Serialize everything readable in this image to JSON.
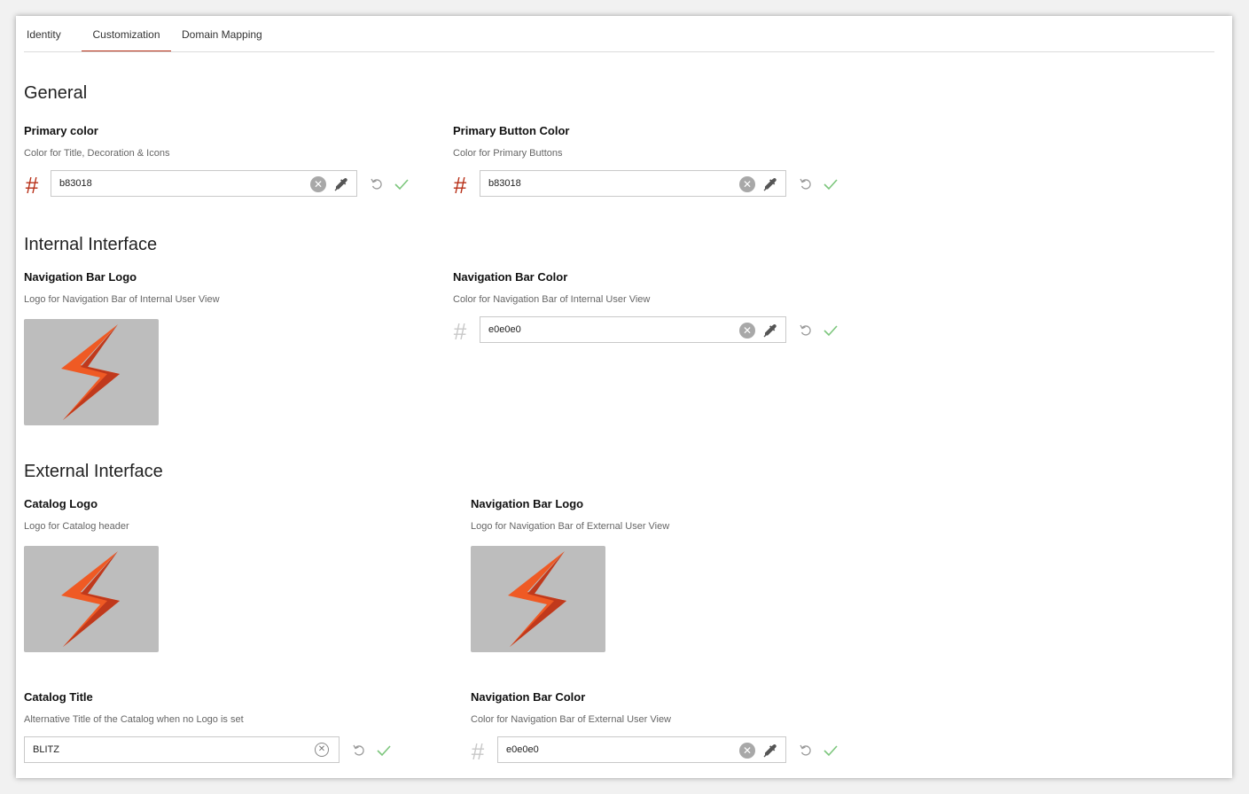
{
  "tabs": [
    {
      "label": "Identity"
    },
    {
      "label": "Customization"
    },
    {
      "label": "Domain Mapping"
    }
  ],
  "active_tab": "Customization",
  "colors": {
    "accent": "#b83018",
    "logo_bg": "#bdbdbd",
    "ok": "#7cc67c"
  },
  "general": {
    "title": "General",
    "primary_color": {
      "label": "Primary color",
      "desc": "Color for Title, Decoration & Icons",
      "value": "b83018",
      "hash": "#"
    },
    "primary_button_color": {
      "label": "Primary Button Color",
      "desc": "Color for Primary Buttons",
      "value": "b83018",
      "hash": "#"
    }
  },
  "internal": {
    "title": "Internal Interface",
    "nav_logo": {
      "label": "Navigation Bar Logo",
      "desc": "Logo for Navigation Bar of Internal User View",
      "icon": "lightning-bolt-icon"
    },
    "nav_color": {
      "label": "Navigation Bar Color",
      "desc": "Color for Navigation Bar of Internal User View",
      "value": "e0e0e0",
      "hash": "#"
    }
  },
  "external": {
    "title": "External Interface",
    "catalog_logo": {
      "label": "Catalog Logo",
      "desc": "Logo for Catalog header",
      "icon": "lightning-bolt-icon"
    },
    "nav_logo": {
      "label": "Navigation Bar Logo",
      "desc": "Logo for Navigation Bar of External User View",
      "icon": "lightning-bolt-icon"
    },
    "catalog_title": {
      "label": "Catalog Title",
      "desc": "Alternative Title of the Catalog when no Logo is set",
      "value": "BLITZ"
    },
    "nav_color": {
      "label": "Navigation Bar Color",
      "desc": "Color for Navigation Bar of External User View",
      "value": "e0e0e0",
      "hash": "#"
    }
  }
}
